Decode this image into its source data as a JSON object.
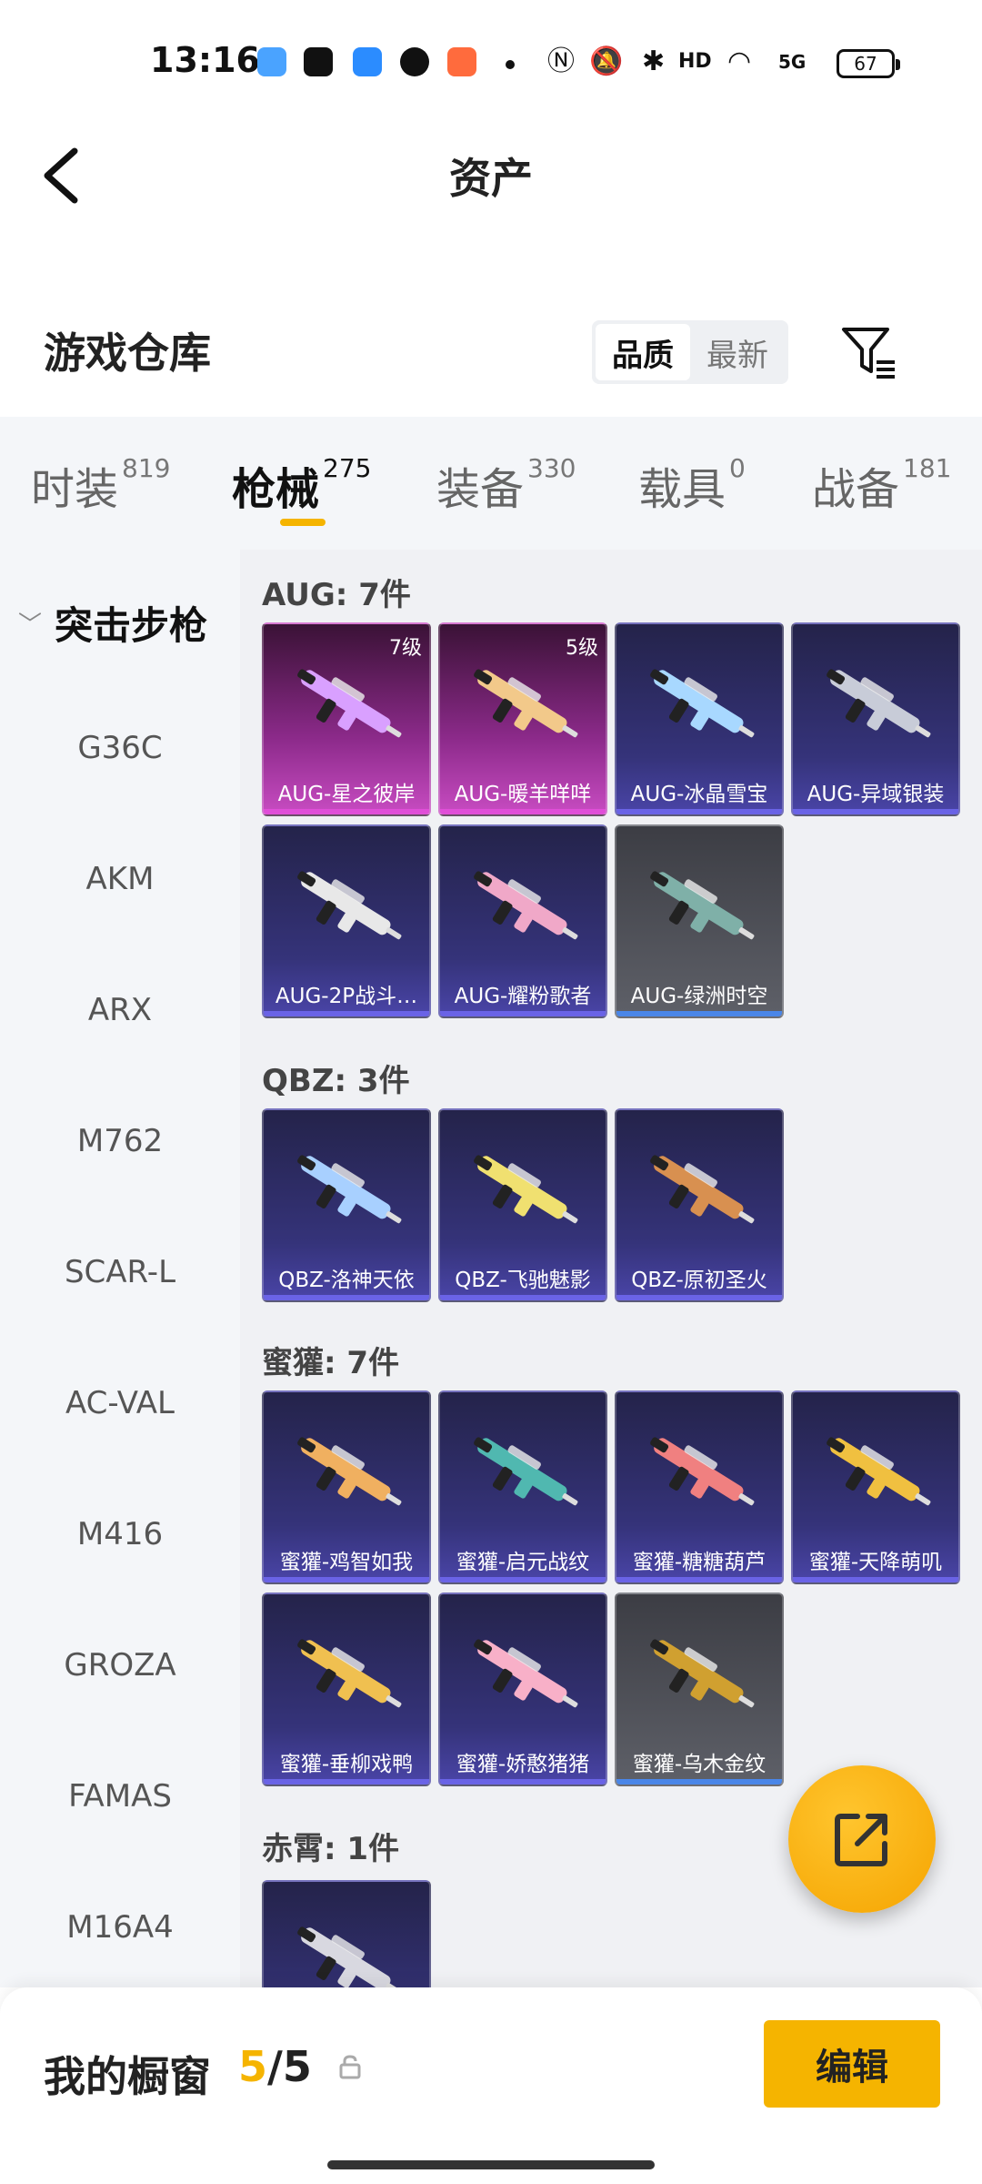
{
  "status": {
    "time": "13:16",
    "battery": "67",
    "network": "5G"
  },
  "header": {
    "title": "资产"
  },
  "warehouse": {
    "title": "游戏仓库",
    "sort_options": [
      "品质",
      "最新"
    ],
    "active_sort": "品质"
  },
  "tabs": [
    {
      "label": "时装",
      "count": "819"
    },
    {
      "label": "枪械",
      "count": "275"
    },
    {
      "label": "装备",
      "count": "330"
    },
    {
      "label": "载具",
      "count": "0"
    },
    {
      "label": "战备",
      "count": "181"
    }
  ],
  "active_tab": "枪械",
  "sidebar": {
    "header": "突击步枪",
    "items": [
      "G36C",
      "AKM",
      "ARX",
      "M762",
      "SCAR-L",
      "AC-VAL",
      "M416",
      "GROZA",
      "FAMAS",
      "M16A4"
    ]
  },
  "groups": [
    {
      "title": "AUG: 7件",
      "items": [
        {
          "name": "AUG-星之彼岸",
          "level": "7级",
          "rarity": "pink",
          "color": "#d9a0ff"
        },
        {
          "name": "AUG-暖羊咩咩",
          "level": "5级",
          "rarity": "pink",
          "color": "#f2c98a"
        },
        {
          "name": "AUG-冰晶雪宝",
          "level": "",
          "rarity": "purple",
          "color": "#a8d8ff"
        },
        {
          "name": "AUG-异域银装",
          "level": "",
          "rarity": "purple",
          "color": "#c8ccd8"
        },
        {
          "name": "AUG-2P战斗…",
          "level": "",
          "rarity": "purple",
          "color": "#e8e8e8"
        },
        {
          "name": "AUG-耀粉歌者",
          "level": "",
          "rarity": "purple",
          "color": "#f0a8c8"
        },
        {
          "name": "AUG-绿洲时空",
          "level": "",
          "rarity": "gray",
          "color": "#7fb0a8"
        }
      ]
    },
    {
      "title": "QBZ: 3件",
      "items": [
        {
          "name": "QBZ-洛神天依",
          "level": "",
          "rarity": "purple",
          "color": "#a8d0ff"
        },
        {
          "name": "QBZ-飞驰魅影",
          "level": "",
          "rarity": "purple",
          "color": "#f0e070"
        },
        {
          "name": "QBZ-原初圣火",
          "level": "",
          "rarity": "purple",
          "color": "#d89050"
        }
      ]
    },
    {
      "title": "蜜獾: 7件",
      "items": [
        {
          "name": "蜜獾-鸡智如我",
          "level": "",
          "rarity": "purple",
          "color": "#f0b060"
        },
        {
          "name": "蜜獾-启元战纹",
          "level": "",
          "rarity": "purple",
          "color": "#50b8b0"
        },
        {
          "name": "蜜獾-糖糖葫芦",
          "level": "",
          "rarity": "purple",
          "color": "#f08080"
        },
        {
          "name": "蜜獾-天降萌叽",
          "level": "",
          "rarity": "purple",
          "color": "#f0c040"
        },
        {
          "name": "蜜獾-垂柳戏鸭",
          "level": "",
          "rarity": "purple",
          "color": "#f0c050"
        },
        {
          "name": "蜜獾-娇憨猪猪",
          "level": "",
          "rarity": "purple",
          "color": "#f8b0c8"
        },
        {
          "name": "蜜獾-乌木金纹",
          "level": "",
          "rarity": "gray",
          "color": "#d0a030"
        }
      ]
    },
    {
      "title": "赤霄: 1件",
      "items": [
        {
          "name": "",
          "level": "",
          "rarity": "purple",
          "color": "#d8d8e0"
        }
      ]
    }
  ],
  "showcase": {
    "label": "我的橱窗",
    "current": "5",
    "separator": "/",
    "total": "5",
    "edit_label": "编辑"
  },
  "colors": {
    "accent": "#f5b400",
    "purple_rarity": "#6a63e6",
    "pink_rarity": "#e04ed8"
  }
}
